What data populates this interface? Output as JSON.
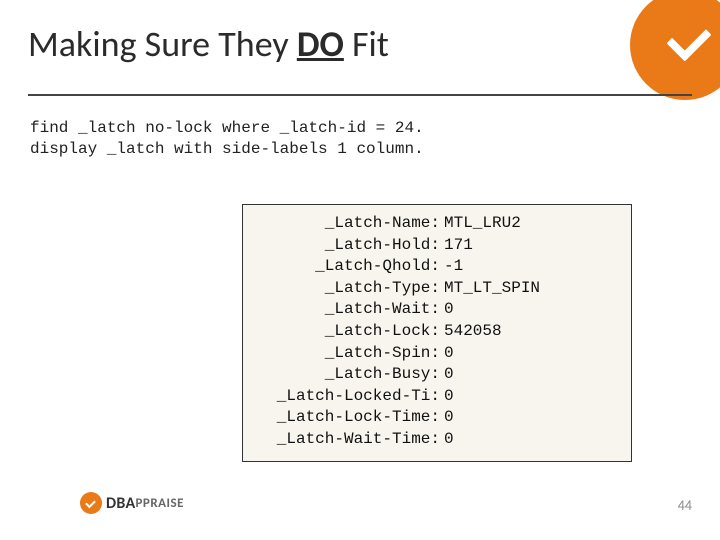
{
  "title": {
    "pre": "Making Sure They ",
    "emph": "DO",
    "post": " Fit"
  },
  "code": "find _latch no-lock where _latch-id = 24.\ndisplay _latch with side-labels 1 column.",
  "output": [
    {
      "label": "_Latch-Name:",
      "value": "MTL_LRU2"
    },
    {
      "label": "_Latch-Hold:",
      "value": "171"
    },
    {
      "label": "_Latch-Qhold:",
      "value": "-1"
    },
    {
      "label": "_Latch-Type:",
      "value": "MT_LT_SPIN"
    },
    {
      "label": "_Latch-Wait:",
      "value": "0"
    },
    {
      "label": "_Latch-Lock:",
      "value": "542058"
    },
    {
      "label": "_Latch-Spin:",
      "value": "0"
    },
    {
      "label": "_Latch-Busy:",
      "value": "0"
    },
    {
      "label": "_Latch-Locked-Ti:",
      "value": "0"
    },
    {
      "label": "_Latch-Lock-Time:",
      "value": "0"
    },
    {
      "label": "_Latch-Wait-Time:",
      "value": "0"
    }
  ],
  "footer": {
    "brand_main": "DBA",
    "brand_sub": "PPRAISE"
  },
  "page_number": "44"
}
